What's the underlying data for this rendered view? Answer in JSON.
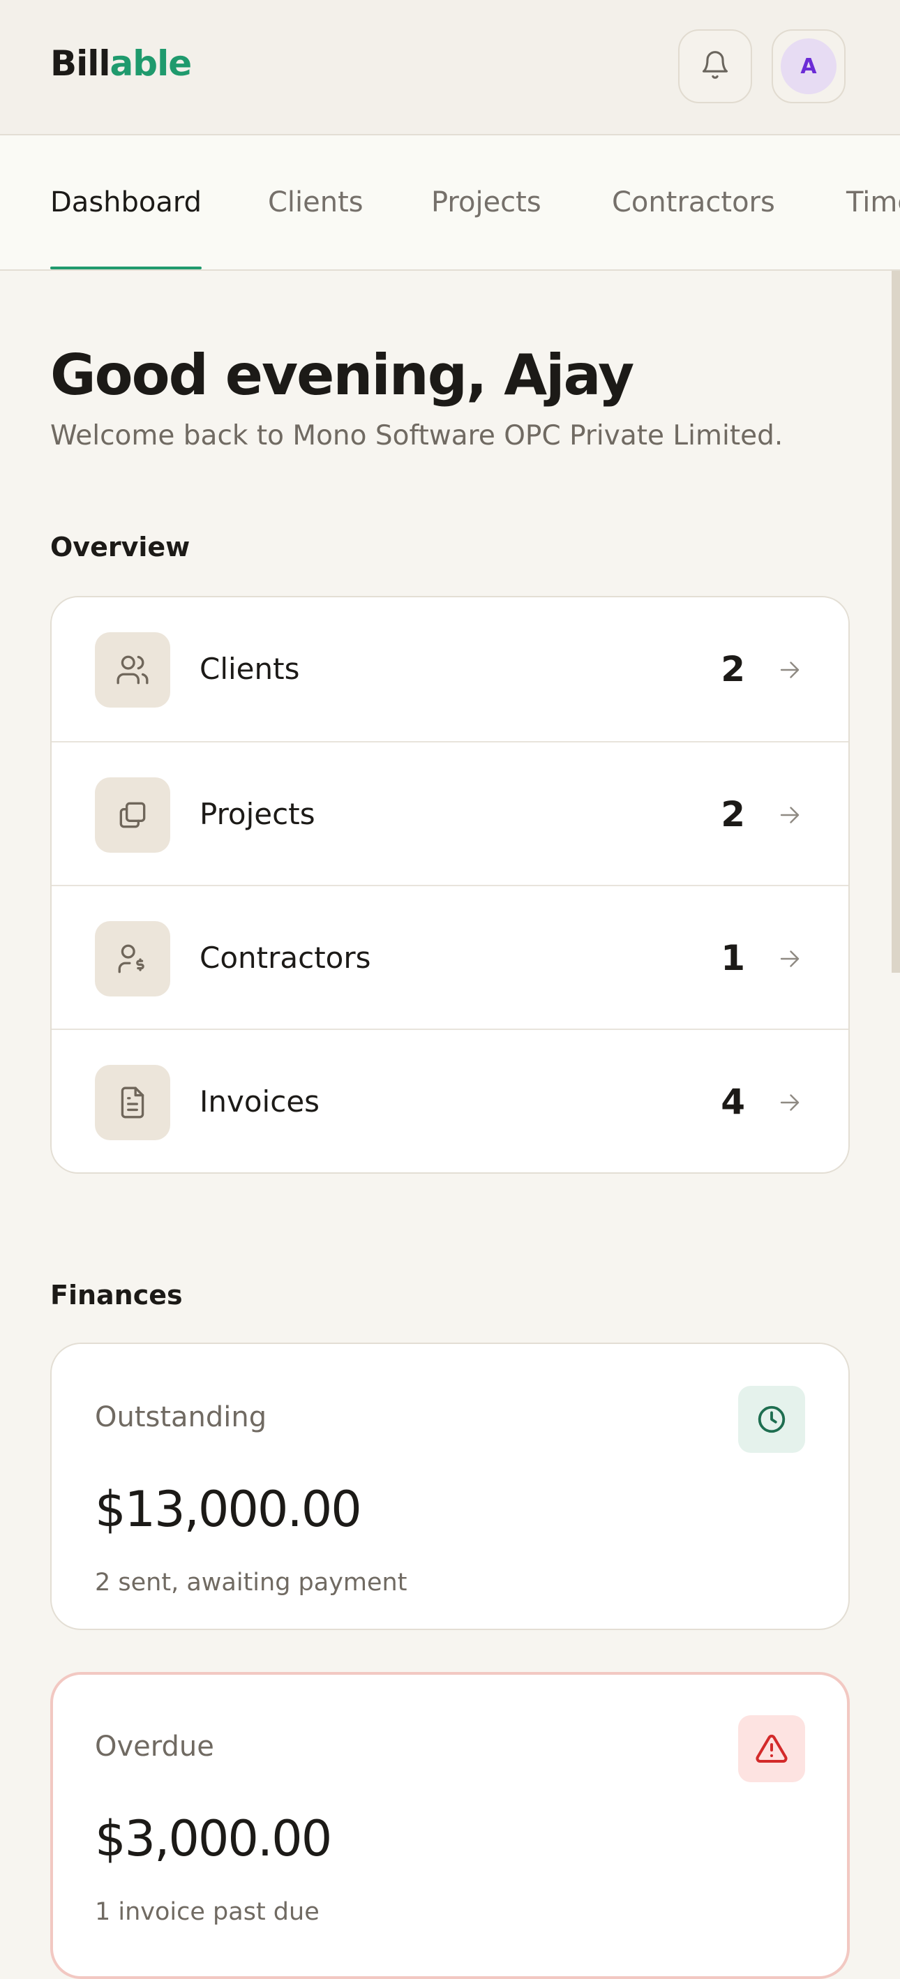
{
  "brand": {
    "name_part1": "Bill",
    "name_part2": "able",
    "accent": "#1f9a6d"
  },
  "header": {
    "notifications_icon": "bell-icon",
    "avatar_initial": "A",
    "avatar_color": "#6b2bd6"
  },
  "tabs": [
    {
      "label": "Dashboard",
      "active": true
    },
    {
      "label": "Clients",
      "active": false
    },
    {
      "label": "Projects",
      "active": false
    },
    {
      "label": "Contractors",
      "active": false
    },
    {
      "label": "Time",
      "active": false
    }
  ],
  "greeting": {
    "title": "Good evening, Ajay",
    "subtitle": "Welcome back to Mono Software OPC Private Limited."
  },
  "overview": {
    "title": "Overview",
    "items": [
      {
        "label": "Clients",
        "count": "2",
        "icon": "users-icon"
      },
      {
        "label": "Projects",
        "count": "2",
        "icon": "folders-icon"
      },
      {
        "label": "Contractors",
        "count": "1",
        "icon": "user-dollar-icon"
      },
      {
        "label": "Invoices",
        "count": "4",
        "icon": "document-icon"
      }
    ]
  },
  "finances": {
    "title": "Finances",
    "outstanding": {
      "label": "Outstanding",
      "amount": "$13,000.00",
      "note": "2 sent, awaiting payment",
      "icon": "clock-icon",
      "icon_color": "#1e6e50"
    },
    "overdue": {
      "label": "Overdue",
      "amount": "$3,000.00",
      "note": "1 invoice past due",
      "icon": "warning-icon",
      "icon_color": "#d32a2a"
    }
  }
}
